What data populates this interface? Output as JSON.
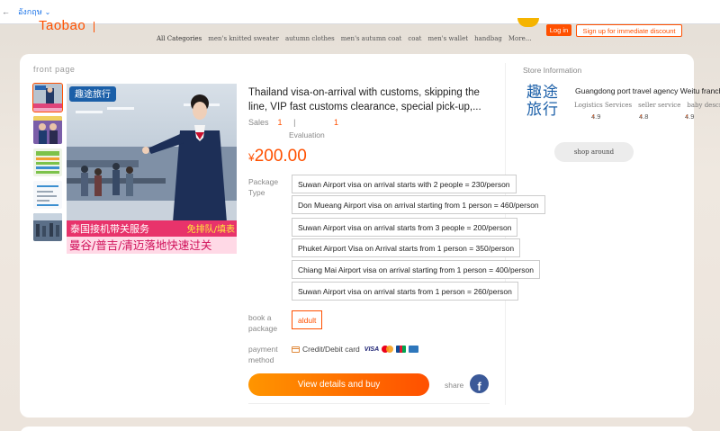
{
  "translate_bar": {
    "back_arrow": "←",
    "language": "อังกฤษ",
    "chevron": "⌄"
  },
  "header": {
    "logo": "Taobao",
    "login": "Log in",
    "signup": "Sign up for immediate discount",
    "categories": [
      "All Categories",
      "men's knitted sweater",
      "autumn clothes",
      "men's autumn coat",
      "coat",
      "men's wallet",
      "handbag",
      "More..."
    ]
  },
  "gallery": {
    "label": "front page",
    "main_image": {
      "badge": "趣途旅行",
      "service_text": "泰国接机带关服务",
      "service_tag": "免排队/填表",
      "cities_text": "曼谷/普吉/清迈落地快速过关"
    }
  },
  "product": {
    "title": "Thailand visa-on-arrival with customs, skipping the line, VIP fast customs clearance, special pick-up,...",
    "sales_label": "Sales",
    "sales_count": "1",
    "sep": "|",
    "evaluation_count": "1",
    "evaluation_label": "Evaluation",
    "currency": "¥",
    "price": "200.00",
    "package_label": "Package Type",
    "packages": [
      "Suwan Airport visa on arrival starts with 2 people = 230/person",
      "Don Mueang Airport visa on arrival starting from 1 person = 460/person",
      "Suwan Airport visa on arrival starts from 3 people = 200/person",
      "Phuket Airport Visa on Arrival starts from 1 person = 350/person",
      "Chiang Mai Airport visa on arrival starting from 1 person = 400/person",
      "Suwan Airport visa on arrival starts from 1 person = 260/person"
    ],
    "book_label": "book a package",
    "book_option": "aldult",
    "payment_label": "payment method",
    "payment_method": "Credit/Debit card",
    "visa": "VISA",
    "buy_button": "View details and buy",
    "share_label": "share",
    "facebook": "f"
  },
  "store": {
    "label": "Store Information",
    "logo_text": "趣途旅行",
    "name": "Guangdong port travel agency Weitu franchise s",
    "metrics": [
      "Logistics Services",
      "seller service",
      "baby description"
    ],
    "scores": [
      "4.9",
      "4.8",
      "4.9"
    ],
    "up_arrow": "↑",
    "shop_button": "shop around"
  }
}
